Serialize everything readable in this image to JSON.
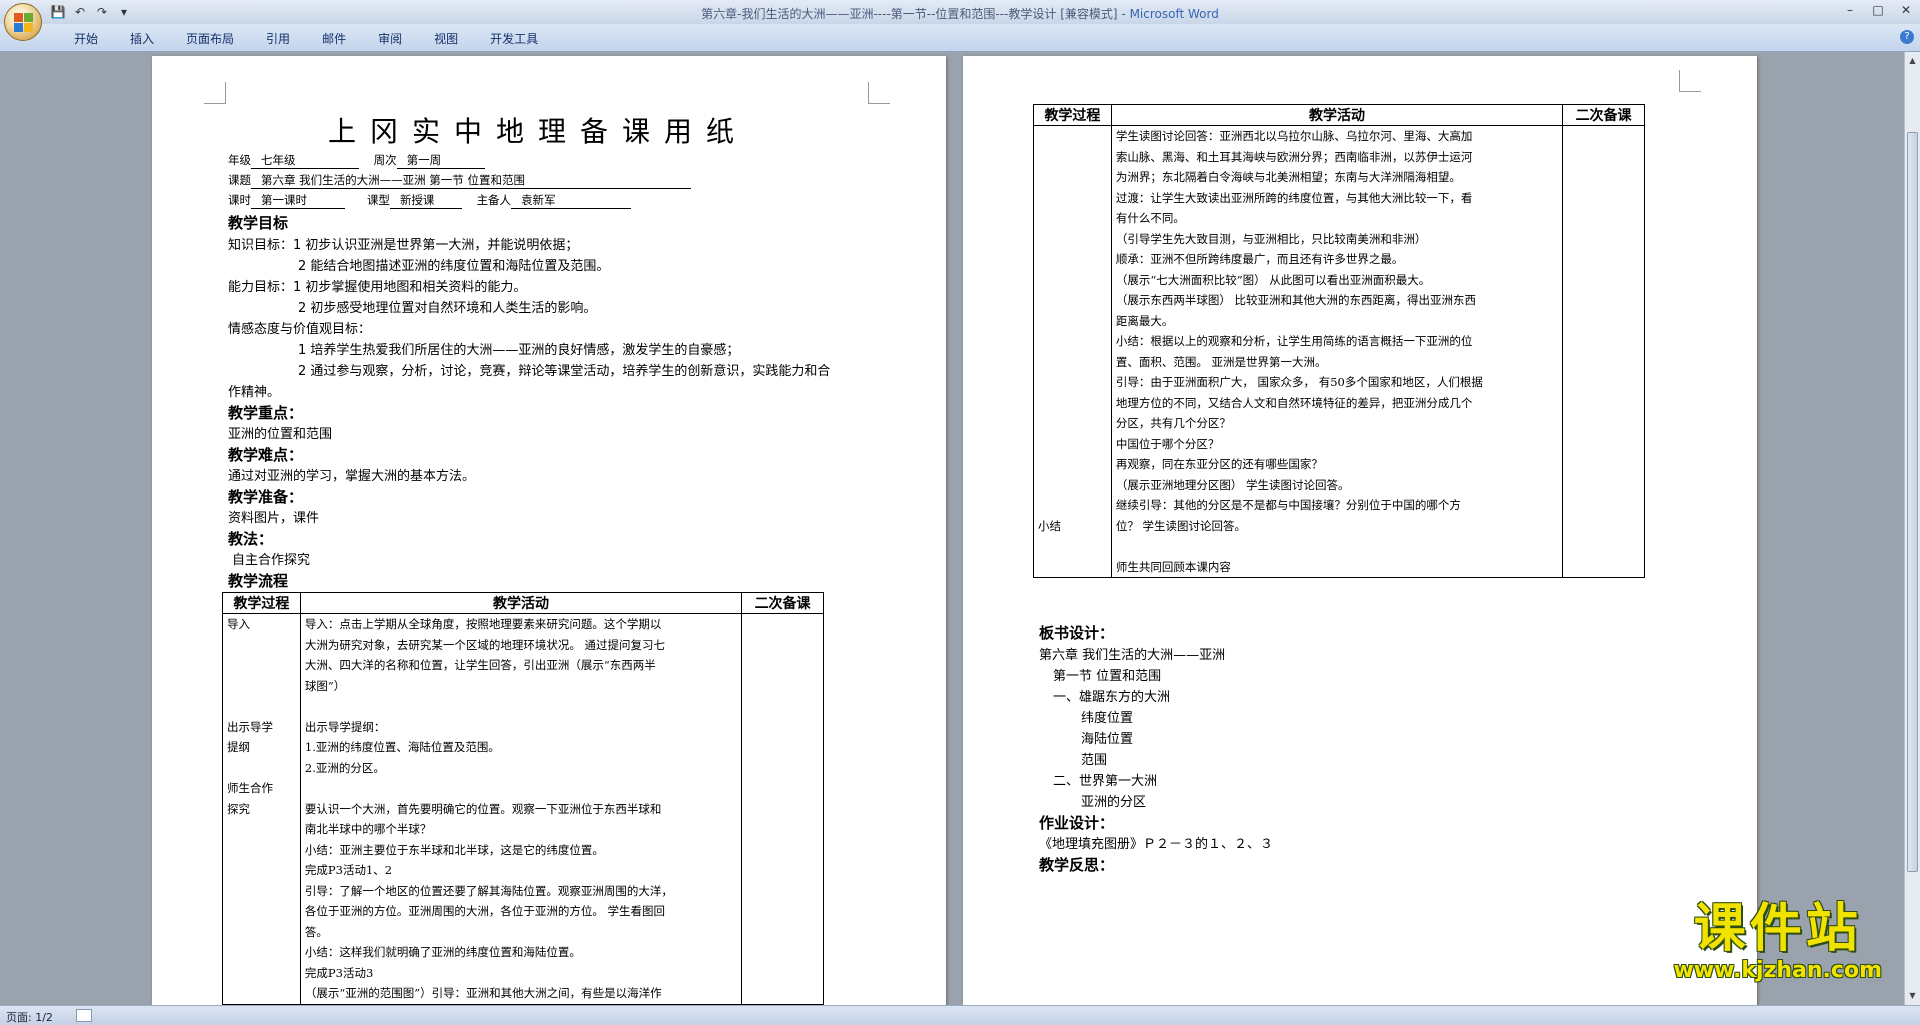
{
  "window": {
    "title": "第六章-我们生活的大洲——亚洲----第一节--位置和范围---教学设计 [兼容模式] - ",
    "app": "Microsoft Word"
  },
  "ribbon": {
    "tabs": [
      "开始",
      "插入",
      "页面布局",
      "引用",
      "邮件",
      "审阅",
      "视图",
      "开发工具"
    ]
  },
  "doc": {
    "title": "上冈实中地理备课用纸",
    "meta": {
      "grade_label": "年级",
      "grade": "七年级",
      "week_label": "周次",
      "week": "第一周",
      "topic_label": "课题",
      "topic": "第六章 我们生活的大洲——亚洲     第一节  位置和范围",
      "period_label": "课时",
      "period": "第一课时",
      "type_label": "课型",
      "type": "新授课",
      "preparer_label": "主备人",
      "preparer": "袁新军"
    },
    "goals_heading": "教学目标",
    "goals": [
      "知识目标：1 初步认识亚洲是世界第一大洲，并能说明依据；",
      "2 能结合地图描述亚洲的纬度位置和海陆位置及范围。",
      "能力目标：1 初步掌握使用地图和相关资料的能力。",
      "2 初步感受地理位置对自然环境和人类生活的影响。",
      "情感态度与价值观目标：",
      "1 培养学生热爱我们所居住的大洲——亚洲的良好情感，激发学生的自豪感；",
      "2 通过参与观察，分析，讨论，竞赛，辩论等课堂活动，培养学生的创新意识，实践能力和合",
      "作精神。"
    ],
    "key_heading": "教学重点：",
    "key": "亚洲的位置和范围",
    "difficult_heading": "教学难点：",
    "difficult": "通过对亚洲的学习，掌握大洲的基本方法。",
    "prep_heading": "教学准备：",
    "prep": "资料图片，课件",
    "method_heading": "教法：",
    "method": "自主合作探究",
    "flow_heading": "教学流程",
    "table_headers": [
      "教学过程",
      "教学活动",
      "二次备课"
    ],
    "left_process": [
      "导入",
      "",
      "",
      "",
      "",
      "出示导学",
      "提纲",
      "",
      "师生合作",
      "探究",
      "",
      "",
      "",
      "",
      "",
      "",
      "",
      "",
      ""
    ],
    "left_activity": [
      "导入：点击上学期从全球角度，按照地理要素来研究问题。这个学期以",
      "大洲为研究对象，去研究某一个区域的地理环境状况。 通过提问复习七",
      "大洲、四大洋的名称和位置，让学生回答，引出亚洲（展示“东西两半",
      "球图”）",
      "",
      "出示导学提纲：",
      "1.亚洲的纬度位置、海陆位置及范围。",
      "2.亚洲的分区。",
      "",
      "要认识一个大洲，首先要明确它的位置。观察一下亚洲位于东西半球和",
      "南北半球中的哪个半球？",
      "小结：亚洲主要位于东半球和北半球，这是它的纬度位置。",
      "完成P3活动1、2",
      "引导：了解一个地区的位置还要了解其海陆位置。观察亚洲周围的大洋，",
      "各位于亚洲的方位。亚洲周围的大洲，各位于亚洲的方位。 学生看图回",
      "答。",
      "小结：这样我们就明确了亚洲的纬度位置和海陆位置。",
      "完成P3活动3",
      "（展示“亚洲的范围图”）引导：亚洲和其他大洲之间，有些是以海洋作"
    ],
    "right_process": [
      "",
      "",
      "",
      "",
      "",
      "",
      "",
      "",
      "",
      "",
      "",
      "",
      "",
      "",
      "",
      "",
      "",
      "",
      "",
      "小结",
      ""
    ],
    "right_activity": [
      "学生读图讨论回答：亚洲西北以乌拉尔山脉、乌拉尔河、里海、大高加",
      "索山脉、黑海、和土耳其海峡与欧洲分界；西南临非洲，以苏伊士运河",
      "为洲界；东北隔着白令海峡与北美洲相望；东南与大洋洲隔海相望。",
      "过渡：让学生大致读出亚洲所跨的纬度位置，与其他大洲比较一下，看",
      "有什么不同。",
      "（引导学生先大致目测，与亚洲相比，只比较南美洲和非洲）",
      "顺承：亚洲不但所跨纬度最广，而且还有许多世界之最。",
      "（展示“七大洲面积比较”图） 从此图可以看出亚洲面积最大。",
      "（展示东西两半球图） 比较亚洲和其他大洲的东西距离，得出亚洲东西",
      "距离最大。",
      "小结：根据以上的观察和分析，让学生用简练的语言概括一下亚洲的位",
      "置、面积、范围。 亚洲是世界第一大洲。",
      "引导：由于亚洲面积广大， 国家众多， 有50多个国家和地区，人们根据",
      "地理方位的不同，又结合人文和自然环境特征的差异，把亚洲分成几个",
      "分区，共有几个分区？",
      "中国位于哪个分区？",
      "再观察，同在东亚分区的还有哪些国家？",
      "（展示亚洲地理分区图） 学生读图讨论回答。",
      "继续引导：其他的分区是不是都与中国接壤？分别位于中国的哪个方",
      "位？ 学生读图讨论回答。",
      "",
      "师生共同回顾本课内容"
    ],
    "board_heading": "板书设计：",
    "board": [
      "第六章 我们生活的大洲——亚洲",
      "第一节   位置和范围",
      "一、雄踞东方的大洲",
      "纬度位置",
      "海陆位置",
      "范围",
      "二、世界第一大洲",
      "亚洲的分区"
    ],
    "homework_heading": "作业设计：",
    "homework": "《地理填充图册》Ｐ２－３的１、２、３",
    "reflection_heading": "教学反思："
  },
  "status": {
    "page": "页面: 1/2"
  },
  "watermark": {
    "text": "课件站",
    "url": "www.kjzhan.com"
  }
}
